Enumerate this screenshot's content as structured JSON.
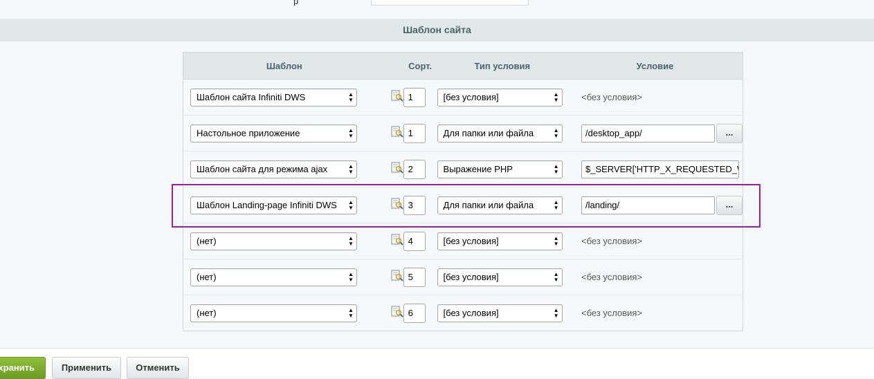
{
  "section": {
    "title": "Шаблон сайта"
  },
  "table": {
    "headers": {
      "template": "Шаблон",
      "sort": "Сорт.",
      "condition_type": "Тип условия",
      "condition": "Условие"
    },
    "rows": [
      {
        "template": "Шаблон сайта Infiniti DWS",
        "sort": "1",
        "condition_type": "[без условия]",
        "condition_text": "<без условия>"
      },
      {
        "template": "Настольное приложение",
        "sort": "1",
        "condition_type": "Для папки или файла",
        "condition_value": "/desktop_app/",
        "button": "..."
      },
      {
        "template": "Шаблон сайта для режима ajax",
        "sort": "2",
        "condition_type": "Выражение PHP",
        "condition_value": "$_SERVER['HTTP_X_REQUESTED_W"
      },
      {
        "template": "Шаблон Landing-page Infiniti DWS",
        "sort": "3",
        "condition_type": "Для папки или файла",
        "condition_value": "/landing/",
        "button": "..."
      },
      {
        "template": "(нет)",
        "sort": "4",
        "condition_type": "[без условия]",
        "condition_text": "<без условия>"
      },
      {
        "template": "(нет)",
        "sort": "5",
        "condition_type": "[без условия]",
        "condition_text": "<без условия>"
      },
      {
        "template": "(нет)",
        "sort": "6",
        "condition_type": "[без условия]",
        "condition_text": "<без условия>"
      }
    ]
  },
  "footer": {
    "save": "хранить",
    "apply": "Применить",
    "cancel": "Отменить"
  },
  "colors": {
    "header_bg": "#e0e8ea",
    "highlight": "#9b1f9e",
    "save_green": "#7aab2e"
  }
}
